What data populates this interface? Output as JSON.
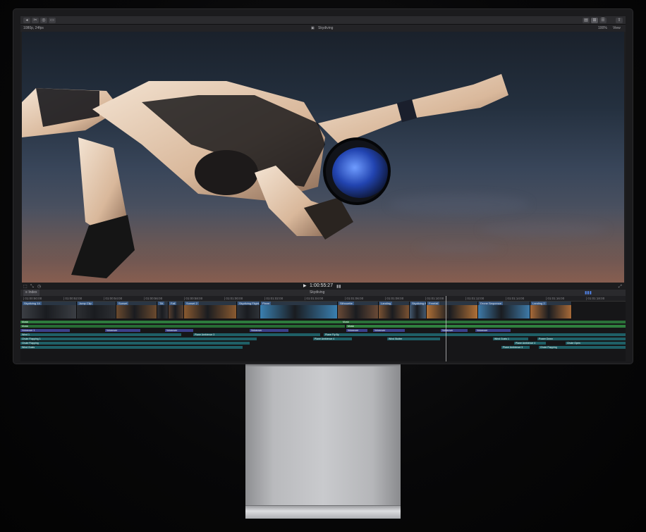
{
  "toolbar": {
    "left_buttons": [
      "◂",
      "✂",
      "◎",
      "▭"
    ],
    "right_buttons": [
      "▤",
      "⊞",
      "☰",
      "⇧"
    ]
  },
  "viewer_bar": {
    "left_label": "1080p, 24fps",
    "title": "Skydiving",
    "zoom": "100%",
    "view": "View"
  },
  "viewer_controls": {
    "timecode": "1:00:55:27"
  },
  "timeline_header": {
    "index_label": "Index",
    "project": "Skydiving"
  },
  "ruler_ticks": [
    "01:00:50:00",
    "01:00:52:00",
    "01:00:54:00",
    "01:00:56:00",
    "01:00:58:00",
    "01:01:00:00",
    "01:01:02:00",
    "01:01:04:00",
    "01:01:06:00",
    "01:01:08:00",
    "01:01:10:00",
    "01:01:12:00",
    "01:01:14:00",
    "01:01:16:00",
    "01:01:18:00"
  ],
  "clips": [
    {
      "label": "Skydiving 14",
      "w": 78,
      "c": "#3b3e44"
    },
    {
      "label": "Jump Clip",
      "w": 56,
      "c": "#2d2f33"
    },
    {
      "label": "Sunset",
      "w": 58,
      "c": "#6b4a2e"
    },
    {
      "label": "Tilt",
      "w": 16,
      "c": "#323236"
    },
    {
      "label": "Fall",
      "w": 22,
      "c": "#584030"
    },
    {
      "label": "Sunset 2",
      "w": 75,
      "c": "#8a5a30"
    },
    {
      "label": "Skydiving Flight",
      "w": 33,
      "c": "#2e3238"
    },
    {
      "label": "Plane",
      "w": 110,
      "c": "#3a7fb0"
    },
    {
      "label": "Silhouette",
      "w": 58,
      "c": "#6a4a36"
    },
    {
      "label": "Landing",
      "w": 44,
      "c": "#7a5232"
    },
    {
      "label": "Skydiving Arms",
      "w": 24,
      "c": "#455a70"
    },
    {
      "label": "Freefall",
      "w": 73,
      "c": "#b07036"
    },
    {
      "label": "Drone Sequence",
      "w": 74,
      "c": "#3e7aa8"
    },
    {
      "label": "Landing 2",
      "w": 59,
      "c": "#a86a38"
    }
  ],
  "lanes": {
    "music_a": {
      "label": "Music",
      "label2": "Music"
    },
    "music_b": {
      "label": "Music",
      "label2": "Music"
    },
    "purple": [
      "Voiceover 1",
      "Voiceover",
      "Voiceover",
      "Voiceover",
      "Voiceover",
      "Voiceover",
      "Voiceover",
      "Voiceover",
      "Voiceover"
    ],
    "teal_rows": [
      [
        "Sound Ambience",
        "Plane Ambience 3",
        "Plane Fly By",
        "Wind 1"
      ],
      [
        "Foly 3D 1",
        "Plane Ambience 4",
        "Wind Stutter",
        "Wind Gusts 1",
        "Power Down",
        "Chute Flapping 1"
      ],
      [
        "Foly 3D 2",
        "Plane Ambience 4",
        "Chute Open",
        "Chute Flapping"
      ],
      [
        "Foly 3D 3",
        "Plane Ambience 3",
        "Chute Flapping",
        "Wind Gusts"
      ]
    ]
  },
  "colors": {
    "music": "#2d7b3c",
    "voiceover": "#3c3f8a",
    "effects": "#1f5f66",
    "clip_label": "#3a5a84"
  }
}
